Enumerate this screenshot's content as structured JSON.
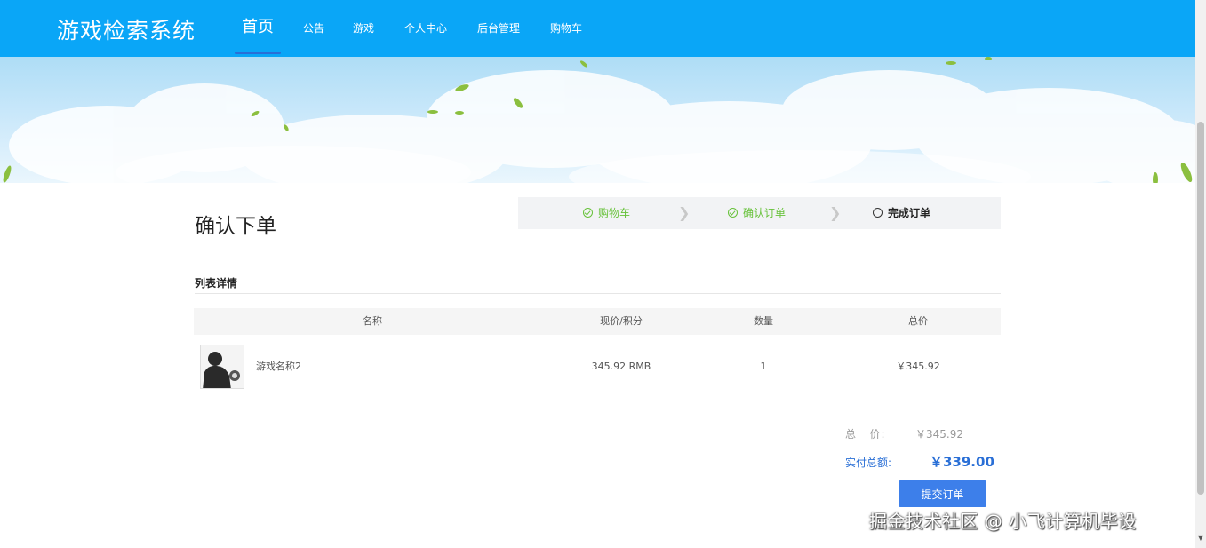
{
  "app": {
    "title": "游戏检索系统"
  },
  "nav": {
    "items": [
      {
        "label": "首页",
        "active": true
      },
      {
        "label": "公告",
        "active": false
      },
      {
        "label": "游戏",
        "active": false
      },
      {
        "label": "个人中心",
        "active": false
      },
      {
        "label": "后台管理",
        "active": false
      },
      {
        "label": "购物车",
        "active": false
      }
    ]
  },
  "page": {
    "title": "确认下单"
  },
  "steps": [
    {
      "label": "购物车",
      "status": "done"
    },
    {
      "label": "确认订单",
      "status": "done"
    },
    {
      "label": "完成订单",
      "status": "todo"
    }
  ],
  "section": {
    "title": "列表详情"
  },
  "table": {
    "headers": [
      "名称",
      "现价/积分",
      "数量",
      "总价"
    ],
    "rows": [
      {
        "name": "游戏名称2",
        "price": "345.92 RMB",
        "quantity": "1",
        "total": "￥345.92"
      }
    ]
  },
  "summary": {
    "total_label": "总   价:",
    "total_value": "￥345.92",
    "pay_label": "实付总额:",
    "pay_value": "￥339.00"
  },
  "actions": {
    "submit_label": "提交订单"
  },
  "watermark": "掘金技术社区 @ 小飞计算机毕设",
  "colors": {
    "nav_bg": "#0aa6f7",
    "accent": "#3d7fea",
    "success": "#67c23a"
  }
}
